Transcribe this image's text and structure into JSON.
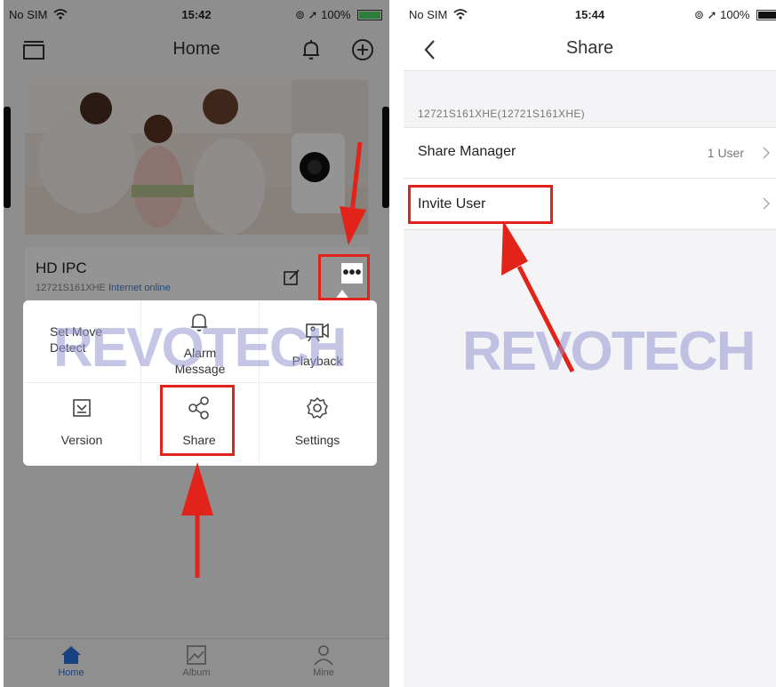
{
  "left": {
    "status": {
      "carrier": "No SIM",
      "time": "15:42",
      "battery": "100%"
    },
    "nav": {
      "title": "Home"
    },
    "device": {
      "name": "HD IPC",
      "serial": "12721S161XHE",
      "status": "Internet online"
    },
    "menu": [
      {
        "label": "Set Move Detect",
        "icon": "motion-detect-icon"
      },
      {
        "label": "Alarm Message",
        "icon": "bell-icon"
      },
      {
        "label": "Playback",
        "icon": "video-camera-icon"
      },
      {
        "label": "Version",
        "icon": "version-icon"
      },
      {
        "label": "Share",
        "icon": "share-icon"
      },
      {
        "label": "Settings",
        "icon": "gear-icon"
      }
    ],
    "tabs": [
      {
        "label": "Home",
        "icon": "home-icon",
        "active": true
      },
      {
        "label": "Album",
        "icon": "album-icon",
        "active": false
      },
      {
        "label": "Mine",
        "icon": "person-icon",
        "active": false
      }
    ]
  },
  "right": {
    "status": {
      "carrier": "No SIM",
      "time": "15:44",
      "battery": "100%"
    },
    "nav": {
      "title": "Share"
    },
    "section_header": "12721S161XHE(12721S161XHE)",
    "rows": [
      {
        "label": "Share Manager",
        "value": "1 User"
      },
      {
        "label": "Invite User",
        "value": ""
      }
    ]
  },
  "watermark": "REVOTECH",
  "colors": {
    "highlight": "#e2231a",
    "accent": "#2b6fdc",
    "watermark": "#9696d2"
  }
}
